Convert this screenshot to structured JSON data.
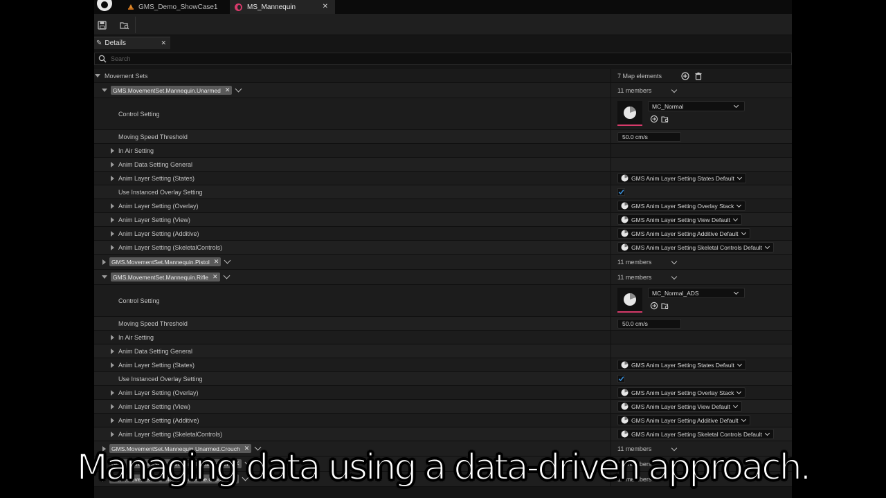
{
  "tabs": {
    "level_tab": "GMS_Demo_ShowCase1",
    "asset_tab": "MS_Mannequin",
    "close_glyph": "✕"
  },
  "details_panel": {
    "tab_label": "Details",
    "close_glyph": "✕",
    "search_placeholder": "Search"
  },
  "movement_sets": {
    "label": "Movement Sets",
    "map_count": "7 Map elements"
  },
  "groups": [
    {
      "key": "GMS.MovementSet.Mannequin.Unarmed",
      "members": "11 members",
      "expanded": true,
      "control_setting_label": "Control Setting",
      "control_setting_value": "MC_Normal",
      "speed_label": "Moving Speed Threshold",
      "speed_value": "50.0 cm/s",
      "in_air_label": "In Air Setting",
      "anim_data_label": "Anim Data Setting General",
      "states_label": "Anim Layer Setting (States)",
      "states_value": "GMS Anim Layer Setting States Default",
      "overlay_toggle_label": "Use Instanced Overlay Setting",
      "overlay_toggle_checked": true,
      "overlay_label": "Anim Layer Setting (Overlay)",
      "overlay_value": "GMS Anim Layer Setting Overlay Stack",
      "view_label": "Anim Layer Setting (View)",
      "view_value": "GMS Anim Layer Setting View Default",
      "additive_label": "Anim Layer Setting (Additive)",
      "additive_value": "GMS Anim Layer Setting Additive Default",
      "skeletal_label": "Anim Layer Setting (SkeletalControls)",
      "skeletal_value": "GMS Anim Layer Setting Skeletal Controls Default"
    },
    {
      "key": "GMS.MovementSet.Mannequin.Pistol",
      "members": "11 members",
      "expanded": false
    },
    {
      "key": "GMS.MovementSet.Mannequin.Rifle",
      "members": "11 members",
      "expanded": true,
      "control_setting_label": "Control Setting",
      "control_setting_value": "MC_Normal_ADS",
      "speed_label": "Moving Speed Threshold",
      "speed_value": "50.0 cm/s",
      "in_air_label": "In Air Setting",
      "anim_data_label": "Anim Data Setting General",
      "states_label": "Anim Layer Setting (States)",
      "states_value": "GMS Anim Layer Setting States Default",
      "overlay_toggle_label": "Use Instanced Overlay Setting",
      "overlay_toggle_checked": true,
      "overlay_label": "Anim Layer Setting (Overlay)",
      "overlay_value": "GMS Anim Layer Setting Overlay Stack",
      "view_label": "Anim Layer Setting (View)",
      "view_value": "GMS Anim Layer Setting View Default",
      "additive_label": "Anim Layer Setting (Additive)",
      "additive_value": "GMS Anim Layer Setting Additive Default",
      "skeletal_label": "Anim Layer Setting (SkeletalControls)",
      "skeletal_value": "GMS Anim Layer Setting Skeletal Controls Default"
    },
    {
      "key": "GMS.MovementSet.Mannequin.Unarmed.Crouch",
      "members": "11 members",
      "expanded": false
    },
    {
      "key": "GMS.MovementSet.Mannequin.Pistol.Crouch",
      "members": "11 members",
      "expanded": false
    },
    {
      "key": "GMS.MovementSet.Mannequin.Rifle.Crouch",
      "members": "11 members",
      "expanded": false
    }
  ],
  "caption": "Managing data using a data-driven approach.",
  "colors": {
    "accent": "#d63a6a",
    "checkbox": "#3a8fd8",
    "panel_bg": "#151515"
  },
  "icons": {
    "save": "save-icon",
    "browse": "browse-asset-icon",
    "add": "add-element-icon",
    "delete": "delete-icon",
    "search": "search-icon",
    "pencil": "pencil-icon"
  }
}
